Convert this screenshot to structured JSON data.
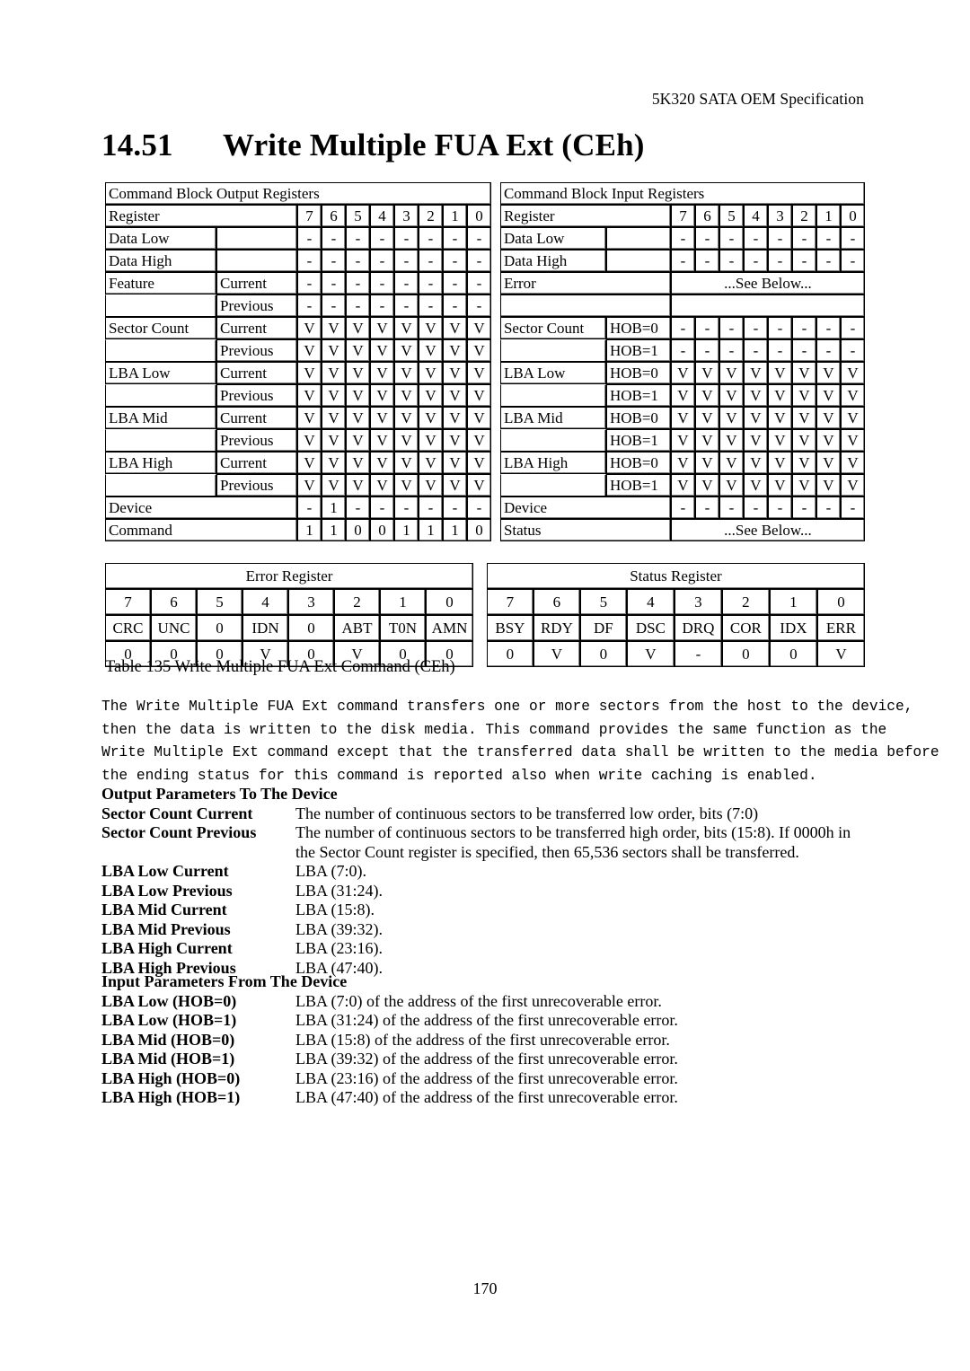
{
  "header": {
    "spec_title": "5K320 SATA OEM Specification"
  },
  "title": {
    "number": "14.51",
    "text": "Write Multiple FUA Ext (CEh)"
  },
  "output_table": {
    "heading": "Command Block Output Registers",
    "register_label": "Register",
    "bit_headers": [
      "7",
      "6",
      "5",
      "4",
      "3",
      "2",
      "1",
      "0"
    ],
    "rows": [
      {
        "name": "Data Low",
        "sub": "",
        "bits": [
          "-",
          "-",
          "-",
          "-",
          "-",
          "-",
          "-",
          "-"
        ]
      },
      {
        "name": "Data High",
        "sub": "",
        "bits": [
          "-",
          "-",
          "-",
          "-",
          "-",
          "-",
          "-",
          "-"
        ]
      },
      {
        "name": "Feature",
        "sub": "Current",
        "bits": [
          "-",
          "-",
          "-",
          "-",
          "-",
          "-",
          "-",
          "-"
        ]
      },
      {
        "name": "",
        "sub": "Previous",
        "bits": [
          "-",
          "-",
          "-",
          "-",
          "-",
          "-",
          "-",
          "-"
        ]
      },
      {
        "name": "Sector Count",
        "sub": "Current",
        "bits": [
          "V",
          "V",
          "V",
          "V",
          "V",
          "V",
          "V",
          "V"
        ]
      },
      {
        "name": "",
        "sub": "Previous",
        "bits": [
          "V",
          "V",
          "V",
          "V",
          "V",
          "V",
          "V",
          "V"
        ]
      },
      {
        "name": "LBA Low",
        "sub": "Current",
        "bits": [
          "V",
          "V",
          "V",
          "V",
          "V",
          "V",
          "V",
          "V"
        ]
      },
      {
        "name": "",
        "sub": "Previous",
        "bits": [
          "V",
          "V",
          "V",
          "V",
          "V",
          "V",
          "V",
          "V"
        ]
      },
      {
        "name": "LBA Mid",
        "sub": "Current",
        "bits": [
          "V",
          "V",
          "V",
          "V",
          "V",
          "V",
          "V",
          "V"
        ]
      },
      {
        "name": "",
        "sub": "Previous",
        "bits": [
          "V",
          "V",
          "V",
          "V",
          "V",
          "V",
          "V",
          "V"
        ]
      },
      {
        "name": "LBA High",
        "sub": "Current",
        "bits": [
          "V",
          "V",
          "V",
          "V",
          "V",
          "V",
          "V",
          "V"
        ]
      },
      {
        "name": "",
        "sub": "Previous",
        "bits": [
          "V",
          "V",
          "V",
          "V",
          "V",
          "V",
          "V",
          "V"
        ]
      },
      {
        "name": "Device",
        "sub": null,
        "bits": [
          "-",
          "1",
          "-",
          "-",
          "-",
          "-",
          "-",
          "-"
        ]
      },
      {
        "name": "Command",
        "sub": null,
        "bits": [
          "1",
          "1",
          "0",
          "0",
          "1",
          "1",
          "1",
          "0"
        ]
      }
    ]
  },
  "input_table": {
    "heading": "Command Block Input Registers",
    "register_label": "Register",
    "bit_headers": [
      "7",
      "6",
      "5",
      "4",
      "3",
      "2",
      "1",
      "0"
    ],
    "see_below": "...See Below...",
    "rows": [
      {
        "name": "Data Low",
        "sub": "",
        "bits": [
          "-",
          "-",
          "-",
          "-",
          "-",
          "-",
          "-",
          "-"
        ]
      },
      {
        "name": "Data High",
        "sub": "",
        "bits": [
          "-",
          "-",
          "-",
          "-",
          "-",
          "-",
          "-",
          "-"
        ]
      },
      {
        "name": "Error",
        "sub": null,
        "span": "...See Below..."
      },
      {
        "name": "",
        "sub": null,
        "span": ""
      },
      {
        "name": "Sector Count",
        "sub": "HOB=0",
        "bits": [
          "-",
          "-",
          "-",
          "-",
          "-",
          "-",
          "-",
          "-"
        ]
      },
      {
        "name": "",
        "sub": "HOB=1",
        "bits": [
          "-",
          "-",
          "-",
          "-",
          "-",
          "-",
          "-",
          "-"
        ]
      },
      {
        "name": "LBA Low",
        "sub": "HOB=0",
        "bits": [
          "V",
          "V",
          "V",
          "V",
          "V",
          "V",
          "V",
          "V"
        ]
      },
      {
        "name": "",
        "sub": "HOB=1",
        "bits": [
          "V",
          "V",
          "V",
          "V",
          "V",
          "V",
          "V",
          "V"
        ]
      },
      {
        "name": "LBA Mid",
        "sub": "HOB=0",
        "bits": [
          "V",
          "V",
          "V",
          "V",
          "V",
          "V",
          "V",
          "V"
        ]
      },
      {
        "name": "",
        "sub": "HOB=1",
        "bits": [
          "V",
          "V",
          "V",
          "V",
          "V",
          "V",
          "V",
          "V"
        ]
      },
      {
        "name": "LBA High",
        "sub": "HOB=0",
        "bits": [
          "V",
          "V",
          "V",
          "V",
          "V",
          "V",
          "V",
          "V"
        ]
      },
      {
        "name": "",
        "sub": "HOB=1",
        "bits": [
          "V",
          "V",
          "V",
          "V",
          "V",
          "V",
          "V",
          "V"
        ]
      },
      {
        "name": "Device",
        "sub": null,
        "bits": [
          "-",
          "-",
          "-",
          "-",
          "-",
          "-",
          "-",
          "-"
        ]
      },
      {
        "name": "Status",
        "sub": null,
        "span": "...See Below..."
      }
    ]
  },
  "error_register": {
    "heading": "Error Register",
    "bits": [
      "7",
      "6",
      "5",
      "4",
      "3",
      "2",
      "1",
      "0"
    ],
    "names": [
      "CRC",
      "UNC",
      "0",
      "IDN",
      "0",
      "ABT",
      "T0N",
      "AMN"
    ],
    "values": [
      "0",
      "0",
      "0",
      "V",
      "0",
      "V",
      "0",
      "0"
    ]
  },
  "status_register": {
    "heading": "Status Register",
    "bits": [
      "7",
      "6",
      "5",
      "4",
      "3",
      "2",
      "1",
      "0"
    ],
    "names": [
      "BSY",
      "RDY",
      "DF",
      "DSC",
      "DRQ",
      "COR",
      "IDX",
      "ERR"
    ],
    "values": [
      "0",
      "V",
      "0",
      "V",
      "-",
      "0",
      "0",
      "V"
    ]
  },
  "caption": "Table 135 Write Multiple FUA Ext Command (CEh)",
  "description_lines": [
    "The Write Multiple FUA Ext command transfers one or more sectors from the host to the device,",
    "then the data is written to the disk media.  This command provides the same function as the",
    "Write Multiple Ext command except that the transferred data shall be written to the media before",
    "the ending status for this command is reported also when write caching is enabled."
  ],
  "output_parameters": {
    "heading": "Output Parameters To The Device",
    "items": [
      {
        "label": "Sector Count Current",
        "desc": "The number of continuous sectors to be transferred low order, bits (7:0)",
        "desc2": ""
      },
      {
        "label": "Sector Count Previous",
        "desc": "The number of continuous sectors to be transferred high order, bits (15:8). If 0000h in",
        "desc2": "the Sector Count register is specified, then 65,536 sectors shall be transferred."
      },
      {
        "label": "LBA Low Current",
        "desc": "LBA (7:0).",
        "desc2": ""
      },
      {
        "label": "LBA Low Previous",
        "desc": "LBA (31:24).",
        "desc2": ""
      },
      {
        "label": "LBA Mid Current",
        "desc": "LBA (15:8).",
        "desc2": ""
      },
      {
        "label": "LBA Mid Previous",
        "desc": "LBA (39:32).",
        "desc2": ""
      },
      {
        "label": "LBA High Current",
        "desc": "LBA (23:16).",
        "desc2": ""
      },
      {
        "label": "LBA High Previous",
        "desc": "LBA (47:40).",
        "desc2": ""
      }
    ]
  },
  "input_parameters": {
    "heading": "Input Parameters From The Device",
    "items": [
      {
        "label": "LBA Low (HOB=0)",
        "desc": "LBA (7:0) of the address of the first unrecoverable error.",
        "desc2": ""
      },
      {
        "label": "LBA Low (HOB=1)",
        "desc": "LBA (31:24) of the address of the first unrecoverable error.",
        "desc2": ""
      },
      {
        "label": "LBA Mid (HOB=0)",
        "desc": "LBA (15:8) of the address of the first unrecoverable error.",
        "desc2": ""
      },
      {
        "label": "LBA Mid (HOB=1)",
        "desc": "LBA (39:32) of the address of the first unrecoverable error.",
        "desc2": ""
      },
      {
        "label": "LBA High (HOB=0)",
        "desc": "LBA (23:16) of the address of the first unrecoverable error.",
        "desc2": ""
      },
      {
        "label": "LBA High (HOB=1)",
        "desc": "LBA (47:40) of the address of the first unrecoverable error.",
        "desc2": ""
      }
    ]
  },
  "page_number": "170"
}
